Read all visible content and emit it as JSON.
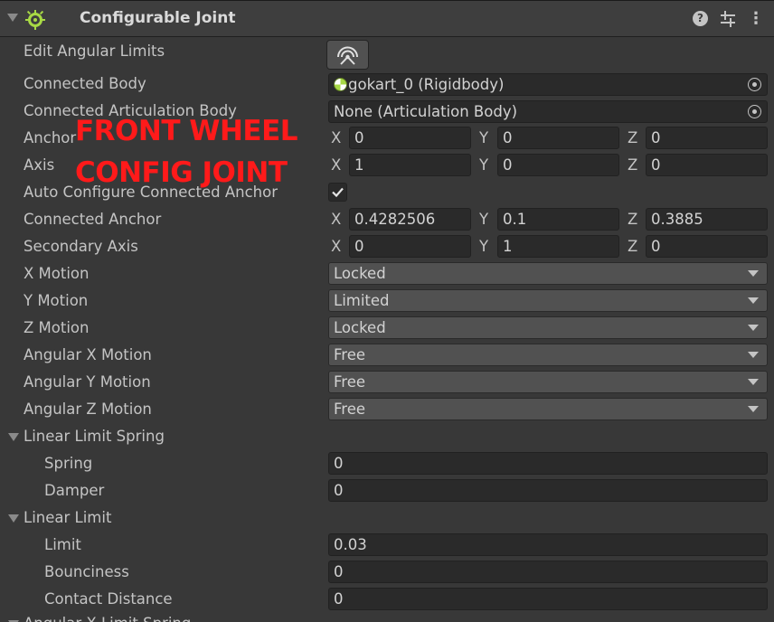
{
  "header": {
    "title": "Configurable Joint",
    "help_glyph": "?",
    "more_glyph": "⋮"
  },
  "rows": {
    "edit_angular_limits": "Edit Angular Limits",
    "connected_body": "Connected Body",
    "connected_body_value": "gokart_0 (Rigidbody)",
    "connected_articulation_body": "Connected Articulation Body",
    "connected_articulation_body_value": "None (Articulation Body)",
    "anchor": "Anchor",
    "anchor_x": "0",
    "anchor_y": "0",
    "anchor_z": "0",
    "axis": "Axis",
    "axis_x": "1",
    "axis_y": "0",
    "axis_z": "0",
    "auto_configure": "Auto Configure Connected Anchor",
    "auto_configure_checked": true,
    "connected_anchor": "Connected Anchor",
    "connected_anchor_x": "0.4282506",
    "connected_anchor_y": "0.1",
    "connected_anchor_z": "0.3885",
    "secondary_axis": "Secondary Axis",
    "secondary_axis_x": "0",
    "secondary_axis_y": "1",
    "secondary_axis_z": "0",
    "x_motion": "X Motion",
    "x_motion_value": "Locked",
    "y_motion": "Y Motion",
    "y_motion_value": "Limited",
    "z_motion": "Z Motion",
    "z_motion_value": "Locked",
    "angular_x_motion": "Angular X Motion",
    "angular_x_motion_value": "Free",
    "angular_y_motion": "Angular Y Motion",
    "angular_y_motion_value": "Free",
    "angular_z_motion": "Angular Z Motion",
    "angular_z_motion_value": "Free",
    "linear_limit_spring": "Linear Limit Spring",
    "spring": "Spring",
    "spring_value": "0",
    "damper": "Damper",
    "damper_value": "0",
    "linear_limit": "Linear Limit",
    "limit": "Limit",
    "limit_value": "0.03",
    "bounciness": "Bounciness",
    "bounciness_value": "0",
    "contact_distance": "Contact Distance",
    "contact_distance_value": "0",
    "next_foldout": "Angular X Limit Spring"
  },
  "axis_letters": {
    "x": "X",
    "y": "Y",
    "z": "Z"
  },
  "overlay": {
    "line1": "FRONT WHEEL",
    "line2": "CONFIG JOINT",
    "color": "#ff1a1a"
  },
  "colors": {
    "panel_bg": "#383838",
    "field_bg": "#2a2a2a",
    "dropdown_bg": "#515151",
    "component_icon": "#a8d945"
  }
}
